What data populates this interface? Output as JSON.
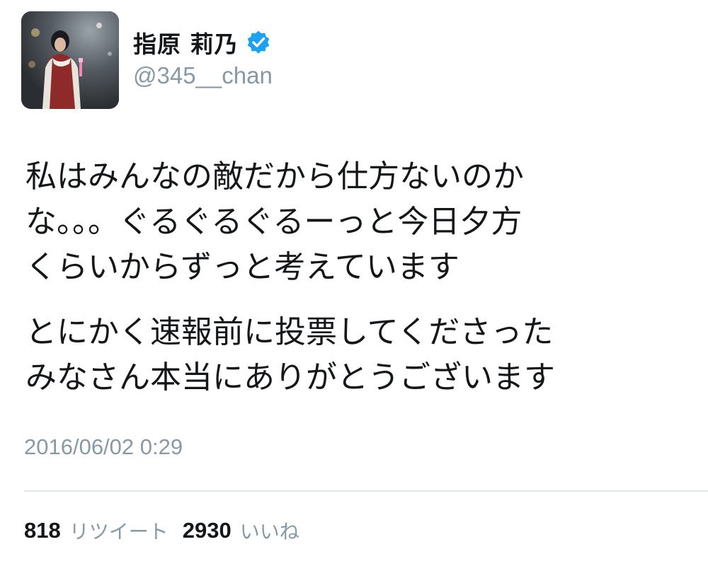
{
  "author": {
    "display_name": "指原 莉乃",
    "handle": "@345__chan",
    "verified": true
  },
  "tweet": {
    "paragraphs": [
      {
        "lines": [
          "私はみんなの敵だから仕方ないのか",
          "な。。。ぐるぐるぐるーっと今日夕方",
          "くらいからずっと考えています"
        ]
      },
      {
        "lines": [
          "とにかく速報前に投票してくださった",
          "みなさん本当にありがとうございます"
        ]
      }
    ],
    "timestamp": "2016/06/02 0:29"
  },
  "stats": {
    "retweets": {
      "count": "818",
      "label": "リツイート"
    },
    "likes": {
      "count": "2930",
      "label": "いいね"
    }
  },
  "colors": {
    "text": "#14171a",
    "secondary": "#8899a6",
    "verified_badge": "#1da1f2",
    "divider": "#e1e8ed"
  },
  "icons": {
    "verified": "verified-badge-icon",
    "avatar": "profile-photo"
  }
}
